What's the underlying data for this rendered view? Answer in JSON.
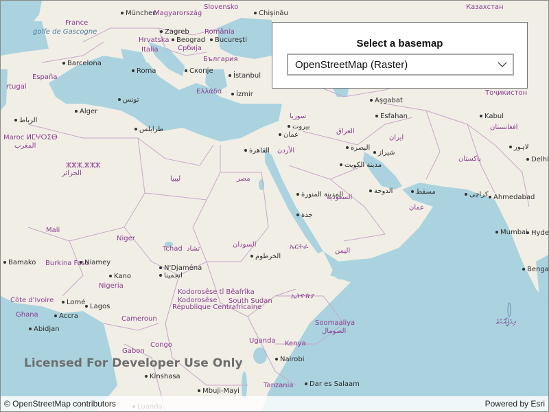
{
  "map": {
    "colors": {
      "water": "#aad3df",
      "land": "#f1eee6",
      "border": "#c9a5c9"
    },
    "labels": [
      {
        "text": "München",
        "cls": "city"
      },
      {
        "text": "Magyarország",
        "cls": "country"
      },
      {
        "text": "Slovensko",
        "cls": "country"
      },
      {
        "text": "Chișinău",
        "cls": "city"
      },
      {
        "text": "Казахстан",
        "cls": "country"
      },
      {
        "text": "France",
        "cls": "country"
      },
      {
        "text": "Zagreb",
        "cls": "city"
      },
      {
        "text": "România",
        "cls": "country"
      },
      {
        "text": "golfe de Gascogne",
        "cls": "sea"
      },
      {
        "text": "Hrvatska",
        "cls": "country"
      },
      {
        "text": "Beograd",
        "cls": "city"
      },
      {
        "text": "București",
        "cls": "city"
      },
      {
        "text": "Italia",
        "cls": "country"
      },
      {
        "text": "Србија",
        "cls": "country"
      },
      {
        "text": "България",
        "cls": "country"
      },
      {
        "text": "Barcelona",
        "cls": "city"
      },
      {
        "text": "Roma",
        "cls": "city"
      },
      {
        "text": "Скопје",
        "cls": "city"
      },
      {
        "text": "İstanbul",
        "cls": "city"
      },
      {
        "text": "España",
        "cls": "country"
      },
      {
        "text": "Ελλάδα",
        "cls": "country"
      },
      {
        "text": "İzmir",
        "cls": "city"
      },
      {
        "text": "rtugal",
        "cls": "country"
      },
      {
        "text": "Aşgabat",
        "cls": "city"
      },
      {
        "text": "Тоҷикистон",
        "cls": "country"
      },
      {
        "text": "Alger",
        "cls": "city"
      },
      {
        "text": "تونس",
        "cls": "city"
      },
      {
        "text": "سوريا",
        "cls": "country"
      },
      {
        "text": "Kabul",
        "cls": "city"
      },
      {
        "text": "طرابلس",
        "cls": "city"
      },
      {
        "text": "بيروت",
        "cls": "city"
      },
      {
        "text": "العراق",
        "cls": "country"
      },
      {
        "text": "Esfahan",
        "cls": "city"
      },
      {
        "text": "افغانستان",
        "cls": "country"
      },
      {
        "text": "عمان",
        "cls": "city"
      },
      {
        "text": "ايران",
        "cls": "country"
      },
      {
        "text": "لاہور",
        "cls": "city"
      },
      {
        "text": "القاهرة",
        "cls": "city"
      },
      {
        "text": "الأردن",
        "cls": "country"
      },
      {
        "text": "البصرة",
        "cls": "city"
      },
      {
        "text": "شيراز",
        "cls": "city"
      },
      {
        "text": "Delhi",
        "cls": "city"
      },
      {
        "text": "مدينة الكويت",
        "cls": "city"
      },
      {
        "text": "پاکستان",
        "cls": "country"
      },
      {
        "text": "ليبيا",
        "cls": "country"
      },
      {
        "text": "مصر",
        "cls": "country"
      },
      {
        "text": "الجزائر",
        "cls": "country"
      },
      {
        "text": "ⵣⵣⵣ.ⵣⵣⵣ",
        "cls": "country"
      },
      {
        "text": "المدينة المنورة",
        "cls": "city"
      },
      {
        "text": "السعودية",
        "cls": "country"
      },
      {
        "text": "الدوحة",
        "cls": "city"
      },
      {
        "text": "مسقط",
        "cls": "city"
      },
      {
        "text": "کراچی",
        "cls": "city"
      },
      {
        "text": "Ahmedabad",
        "cls": "city"
      },
      {
        "text": "جدة",
        "cls": "city"
      },
      {
        "text": "عمان",
        "cls": "country"
      },
      {
        "text": "Mali",
        "cls": "country"
      },
      {
        "text": "Niger",
        "cls": "country"
      },
      {
        "text": "Mumbai",
        "cls": "city"
      },
      {
        "text": "Hyder",
        "cls": "city"
      },
      {
        "text": "Tchad",
        "cls": "country"
      },
      {
        "text": "تشاد",
        "cls": "country"
      },
      {
        "text": "السودان",
        "cls": "country"
      },
      {
        "text": "ኤርትራ",
        "cls": "country"
      },
      {
        "text": "الخرطوم",
        "cls": "city"
      },
      {
        "text": "اليمن",
        "cls": "country"
      },
      {
        "text": "Bamako",
        "cls": "city"
      },
      {
        "text": "Burkina Faso",
        "cls": "country"
      },
      {
        "text": "Niamey",
        "cls": "city"
      },
      {
        "text": "N'Djaména",
        "cls": "city"
      },
      {
        "text": "انجمينا",
        "cls": "city"
      },
      {
        "text": "Benga",
        "cls": "city"
      },
      {
        "text": "Kano",
        "cls": "city"
      },
      {
        "text": "Nigeria",
        "cls": "country"
      },
      {
        "text": "Kodorosêse tî Bêafrîka",
        "cls": "country"
      },
      {
        "text": "République Centrafricaine",
        "cls": "country"
      },
      {
        "text": "South Sudan",
        "cls": "country"
      },
      {
        "text": "ኢትዮጵያ",
        "cls": "country"
      },
      {
        "text": "Côte d'Ivoire",
        "cls": "country"
      },
      {
        "text": "Lomé",
        "cls": "city"
      },
      {
        "text": "Lagos",
        "cls": "city"
      },
      {
        "text": "Accra",
        "cls": "city"
      },
      {
        "text": "Ghana",
        "cls": "country"
      },
      {
        "text": "Abidjan",
        "cls": "city"
      },
      {
        "text": "Cameroun",
        "cls": "country"
      },
      {
        "text": "Soomaaliya",
        "cls": "country"
      },
      {
        "text": "الصومال",
        "cls": "country"
      },
      {
        "text": "ދިވެހިރާއްޖެ",
        "cls": "country"
      },
      {
        "text": "Uganda",
        "cls": "country"
      },
      {
        "text": "Gabon",
        "cls": "country"
      },
      {
        "text": "Congo",
        "cls": "country"
      },
      {
        "text": "Kenya",
        "cls": "country"
      },
      {
        "text": "Nairobi",
        "cls": "city"
      },
      {
        "text": "Kinshasa",
        "cls": "city"
      },
      {
        "text": "Tanzania",
        "cls": "country"
      },
      {
        "text": "Dar es Salaam",
        "cls": "city"
      },
      {
        "text": "Mbuji-Mayi",
        "cls": "city"
      },
      {
        "text": "Luanda",
        "cls": "city"
      },
      {
        "text": "Maroc ⵍⵎⵖⵔⵉⴱ",
        "cls": "country"
      },
      {
        "text": "المغرب",
        "cls": "country"
      },
      {
        "text": "الرباط",
        "cls": "city"
      },
      {
        "text": "Kodorosêse",
        "cls": "country"
      }
    ],
    "watermark": "Licensed For Developer Use Only",
    "attribution": "© OpenStreetMap contributors",
    "powered_by": "Powered by Esri"
  },
  "panel": {
    "title": "Select a basemap",
    "selected_value": "OpenStreetMap (Raster)"
  }
}
